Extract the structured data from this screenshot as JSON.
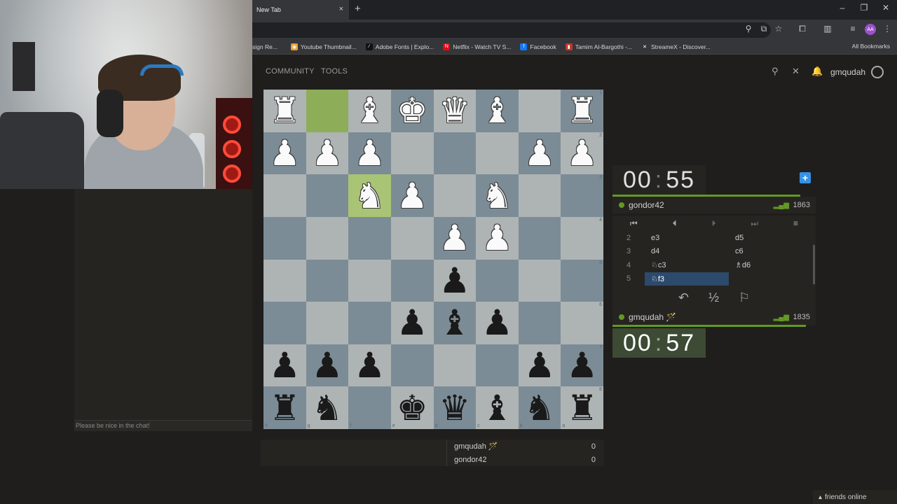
{
  "browser": {
    "tab_title": "New Tab",
    "tab_close_icon": "×",
    "new_tab_icon": "+",
    "window_controls": [
      "–",
      "❐",
      "✕"
    ],
    "bookmarks": [
      {
        "label": "sign Re...",
        "icon": "",
        "color": "#35363a"
      },
      {
        "label": "Youtube Thumbnail...",
        "icon": "◉",
        "color": "#e8a030"
      },
      {
        "label": "Adobe Fonts | Explo...",
        "icon": "∕",
        "color": "#111111"
      },
      {
        "label": "Netflix - Watch TV S...",
        "icon": "N",
        "color": "#e50914"
      },
      {
        "label": "Facebook",
        "icon": "f",
        "color": "#1877f2"
      },
      {
        "label": "Tamim Al-Bargothi -...",
        "icon": "▮",
        "color": "#c0392b"
      },
      {
        "label": "StreameX - Discover...",
        "icon": "✕",
        "color": "#35363a"
      }
    ],
    "all_bookmarks": "All Bookmarks",
    "profile_initials": "AA"
  },
  "site": {
    "nav": [
      "COMMUNITY",
      "TOOLS"
    ],
    "username": "gmqudah"
  },
  "chat": {
    "placeholder": "Please be nice in the chat!"
  },
  "board": {
    "rows": [
      [
        "wR",
        "",
        "wB",
        "wK",
        "wQ",
        "wB",
        "",
        "wR"
      ],
      [
        "wP",
        "wP",
        "wP",
        "",
        "",
        "",
        "wP",
        "wP"
      ],
      [
        "",
        "",
        "wN",
        "wP",
        "",
        "wN",
        "",
        ""
      ],
      [
        "",
        "",
        "",
        "",
        "wP",
        "wP",
        "",
        ""
      ],
      [
        "",
        "",
        "",
        "",
        "bP",
        "",
        "",
        ""
      ],
      [
        "",
        "",
        "",
        "bP",
        "bB",
        "bP",
        "",
        ""
      ],
      [
        "bP",
        "bP",
        "bP",
        "",
        "",
        "",
        "bP",
        "bP"
      ],
      [
        "bR",
        "bN",
        "",
        "bK",
        "bQ",
        "bB",
        "bN",
        "bR"
      ]
    ],
    "highlights": [
      [
        0,
        1
      ],
      [
        2,
        2
      ]
    ],
    "rank_labels": [
      "1",
      "2",
      "3",
      "4",
      "5",
      "6",
      "7",
      "8"
    ],
    "file_labels": [
      "h",
      "g",
      "f",
      "e",
      "d",
      "c",
      "b",
      "a"
    ]
  },
  "players": {
    "top": {
      "name": "gondor42",
      "rating": "1863",
      "clock_min": "00",
      "clock_sec": "55"
    },
    "bottom": {
      "name": "gmqudah 🪄",
      "rating": "1835",
      "clock_min": "00",
      "clock_sec": "57"
    }
  },
  "moves": [
    {
      "n": "2",
      "white": "e3",
      "black": "d5"
    },
    {
      "n": "3",
      "white": "d4",
      "black": "c6"
    },
    {
      "n": "4",
      "white": "♘c3",
      "black": "♗d6"
    },
    {
      "n": "5",
      "white": "♘f3",
      "black": ""
    }
  ],
  "crosstable": [
    {
      "name": "gmqudah 🪄",
      "score": "0"
    },
    {
      "name": "gondor42",
      "score": "0"
    }
  ],
  "friends": "friends online",
  "colors": {
    "accent_green": "#629924",
    "highlight_blue": "#2c4a6b",
    "plus_blue": "#3692e7"
  }
}
